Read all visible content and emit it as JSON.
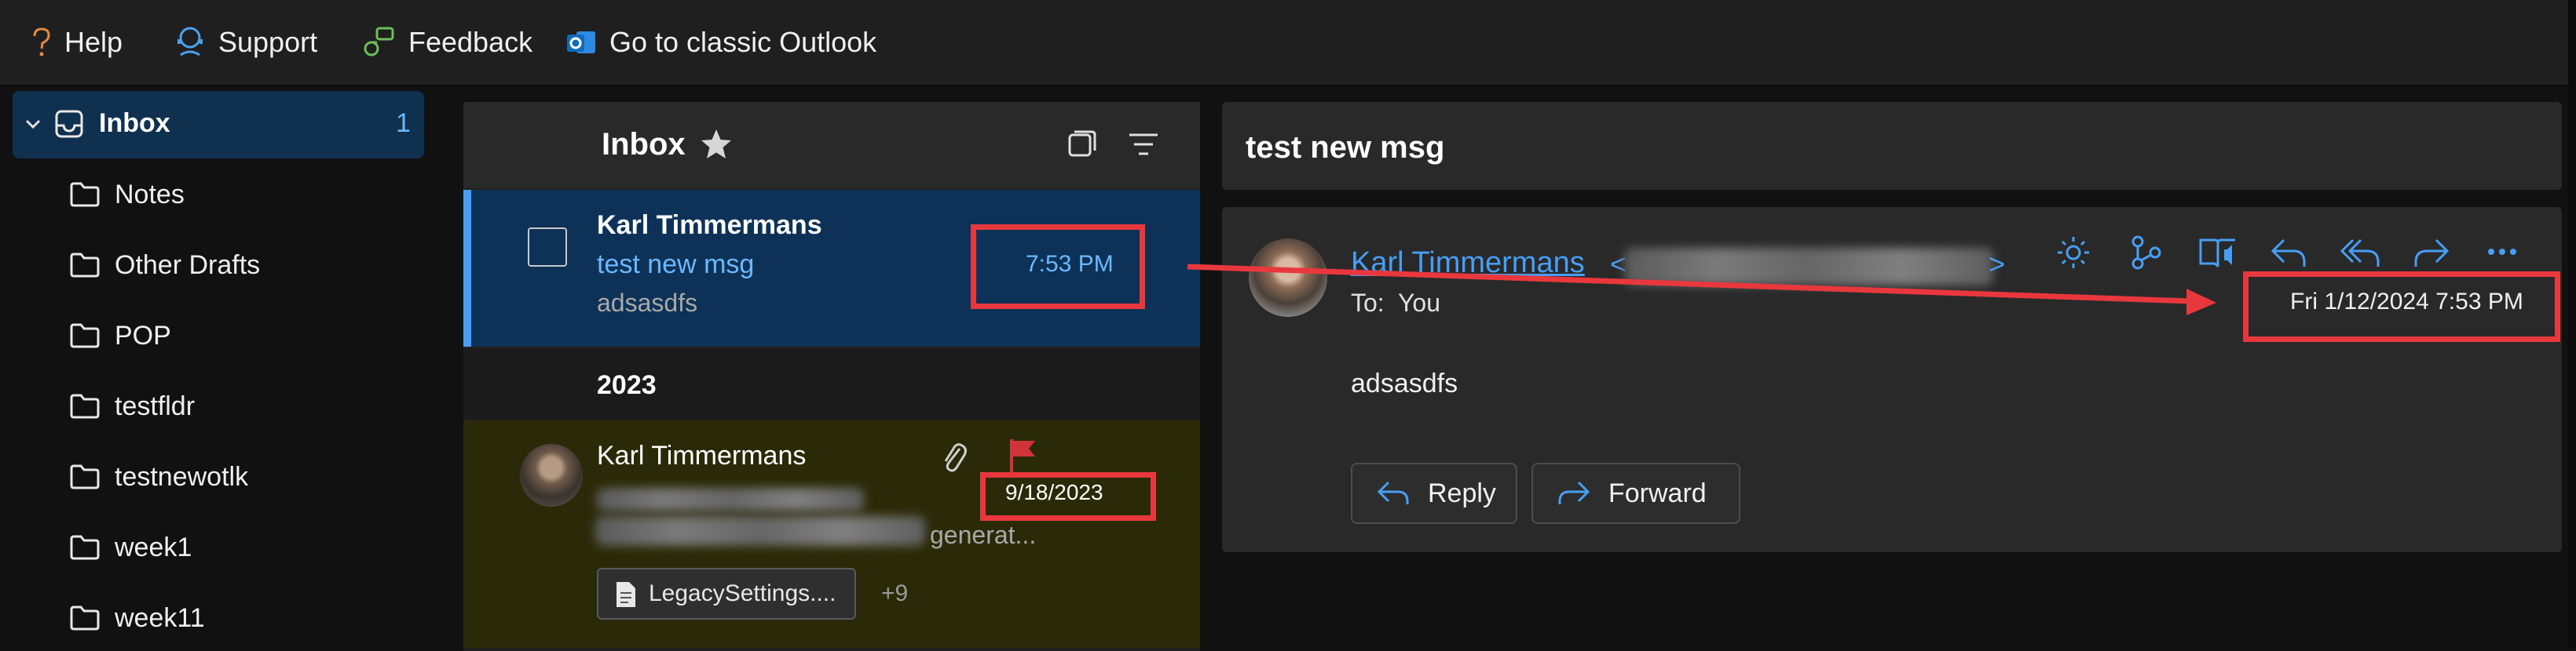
{
  "topbar": {
    "help_label": "Help",
    "support_label": "Support",
    "feedback_label": "Feedback",
    "classic_label": "Go to classic Outlook"
  },
  "sidebar": {
    "inbox": {
      "label": "Inbox",
      "count": "1"
    },
    "folders": [
      {
        "label": "Notes"
      },
      {
        "label": "Other Drafts"
      },
      {
        "label": "POP"
      },
      {
        "label": "testfldr"
      },
      {
        "label": "testnewotlk"
      },
      {
        "label": "week1"
      },
      {
        "label": "week11"
      }
    ]
  },
  "message_list": {
    "title": "Inbox",
    "messages": [
      {
        "sender": "Karl Timmermans",
        "subject": "test new msg",
        "preview": "adsasdfs",
        "time": "7:53 PM"
      }
    ],
    "group_label": "2023",
    "older": {
      "sender": "Karl Timmermans",
      "preview_tail": "generat...",
      "date": "9/18/2023",
      "attachment_name": "LegacySettings....",
      "attachment_more": "+9"
    }
  },
  "reading": {
    "subject": "test new msg",
    "from_name": "Karl Timmermans",
    "from_open": "<",
    "from_close": ">",
    "to_label": "To:",
    "to_value": "You",
    "datetime": "Fri 1/12/2024 7:53 PM",
    "body": "adsasdfs",
    "reply_label": "Reply",
    "forward_label": "Forward"
  },
  "colors": {
    "accent": "#479ef5",
    "selected_row": "#0e3257",
    "flag": "#d13438",
    "highlight": "#e8383d"
  }
}
